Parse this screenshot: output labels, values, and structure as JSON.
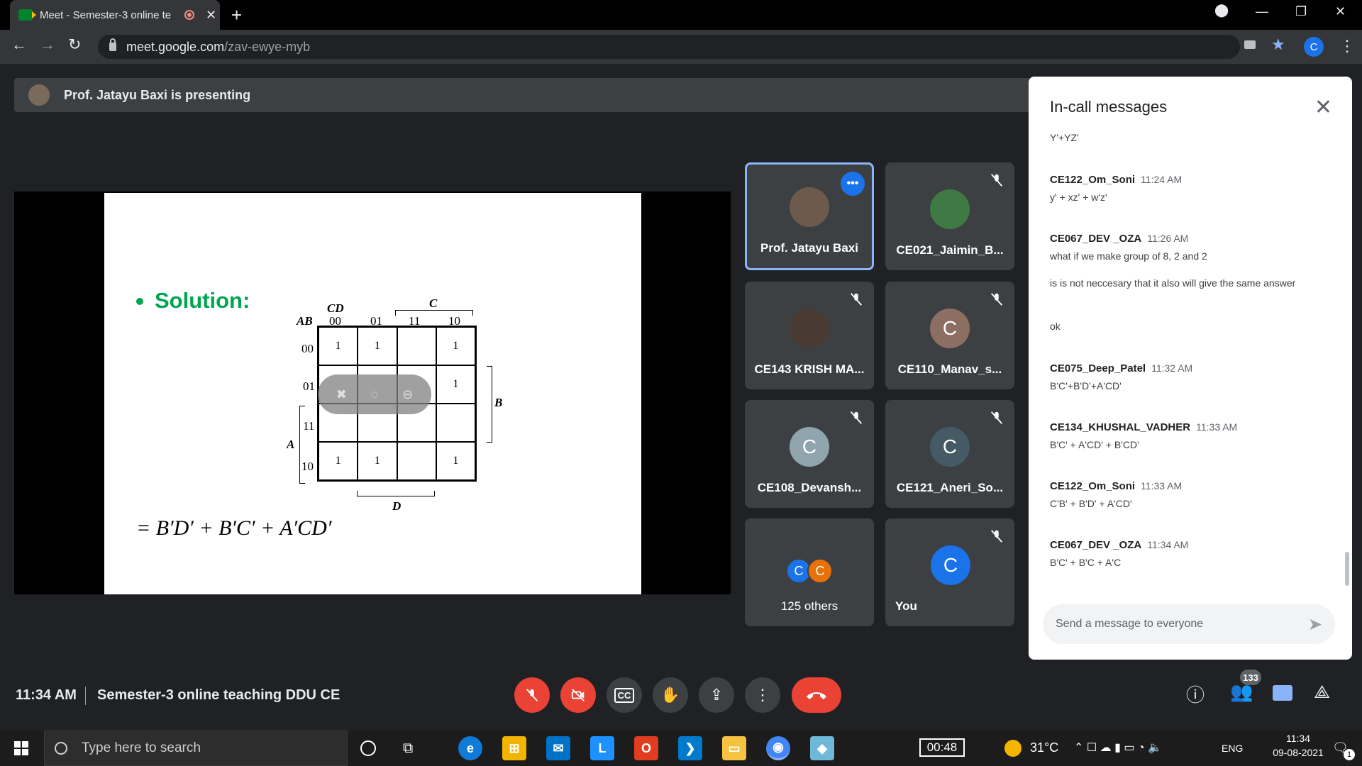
{
  "browser": {
    "tab_title": "Meet - Semester-3 online te",
    "url_host": "meet.google.com",
    "url_path": "/zav-ewye-myb",
    "profile_initial": "C"
  },
  "banner": {
    "text": "Prof. Jatayu Baxi is presenting"
  },
  "slide": {
    "heading": "Solution:",
    "kmap": {
      "row_var": "AB",
      "col_var": "CD",
      "col_headers": [
        "00",
        "01",
        "11",
        "10"
      ],
      "row_headers": [
        "00",
        "01",
        "11",
        "10"
      ],
      "cells": [
        [
          "1",
          "1",
          "",
          "1"
        ],
        [
          "",
          "",
          "",
          "1"
        ],
        [
          "",
          "",
          "",
          ""
        ],
        [
          "1",
          "1",
          "",
          "1"
        ]
      ],
      "group_labels": {
        "top": "C",
        "right": "B",
        "left": "A",
        "bottom": "D"
      }
    },
    "formula": "= B′D′ + B′C′ + A′CD′"
  },
  "participants": [
    {
      "name": "Prof. Jatayu Baxi",
      "avatar": "photo",
      "color": "#6d5a4c",
      "muted": false,
      "active": true
    },
    {
      "name": "CE021_Jaimin_B...",
      "avatar": "photo",
      "color": "#3f7a44",
      "muted": true
    },
    {
      "name": "CE143 KRISH MA...",
      "avatar": "photo",
      "color": "#4a3b32",
      "muted": true
    },
    {
      "name": "CE110_Manav_s...",
      "avatar": "C",
      "color": "#8d6e63",
      "muted": true
    },
    {
      "name": "CE108_Devansh...",
      "avatar": "C",
      "color": "#90a4ae",
      "muted": true
    },
    {
      "name": "CE121_Aneri_So...",
      "avatar": "C",
      "color": "#455a64",
      "muted": true
    },
    {
      "name": "125 others",
      "avatar": "group",
      "muted": false
    },
    {
      "name": "You",
      "avatar": "C",
      "color": "#1a73e8",
      "muted": true
    }
  ],
  "chat": {
    "title": "In-call messages",
    "messages": [
      {
        "sender": "",
        "time": "",
        "text": "Y'+YZ'"
      },
      {
        "sender": "CE122_Om_Soni",
        "time": "11:24 AM",
        "text": "y' + xz' + w'z'"
      },
      {
        "sender": "CE067_DEV _OZA",
        "time": "11:26 AM",
        "text": "what if we make group of 8, 2 and 2"
      },
      {
        "sender": "",
        "time": "",
        "text": "is is not neccesary that it also will give the same answer"
      },
      {
        "sender": "",
        "time": "",
        "text": "ok"
      },
      {
        "sender": "CE075_Deep_Patel",
        "time": "11:32 AM",
        "text": "B'C'+B'D'+A'CD'"
      },
      {
        "sender": "CE134_KHUSHAL_VADHER",
        "time": "11:33 AM",
        "text": "B'C' + A'CD' + B'CD'"
      },
      {
        "sender": "CE122_Om_Soni",
        "time": "11:33 AM",
        "text": "C'B' + B'D' + A'CD'"
      },
      {
        "sender": "CE067_DEV _OZA",
        "time": "11:34 AM",
        "text": "B'C' + B'C + A'C"
      }
    ],
    "input_placeholder": "Send a message to everyone"
  },
  "bottom": {
    "time": "11:34 AM",
    "meeting_title": "Semester-3 online teaching DDU CE",
    "people_count": "133"
  },
  "taskbar": {
    "search_placeholder": "Type here to search",
    "timer": "00:48",
    "weather": "31°C",
    "lang": "ENG",
    "clock_time": "11:34",
    "clock_date": "09-08-2021",
    "notif_count": "1"
  },
  "colors": {
    "meet_bg": "#202124",
    "tile_bg": "#3c4043",
    "accent": "#1a73e8",
    "danger": "#ea4335",
    "slide_green": "#00a550"
  }
}
